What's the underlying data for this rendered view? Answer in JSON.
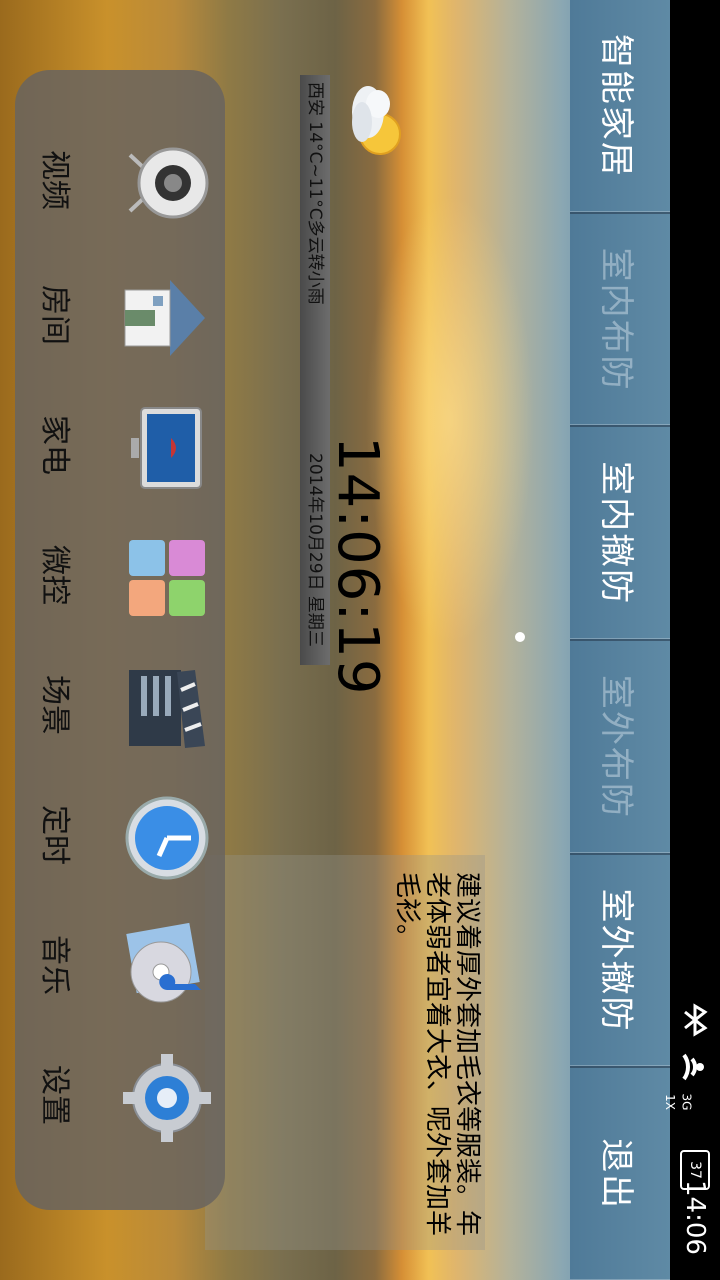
{
  "status_bar": {
    "time": "14:06",
    "battery": "37",
    "network_3g": "3G",
    "network_1x": "1X"
  },
  "menu": {
    "items": [
      {
        "label": "智能家居",
        "dim": false
      },
      {
        "label": "室内布防",
        "dim": true
      },
      {
        "label": "室内撤防",
        "dim": false
      },
      {
        "label": "室外布防",
        "dim": true
      },
      {
        "label": "室外撤防",
        "dim": false
      },
      {
        "label": "退出",
        "dim": false
      }
    ]
  },
  "weather": {
    "text": "西安 14°C~11°C多云转小雨",
    "icon": "cloudy-sun-icon"
  },
  "clock": {
    "time": "14:06:19",
    "date": "2014年10月29日 星期三"
  },
  "advice": {
    "text": "建议着厚外套加毛衣等服装。年老体弱者宜着大衣、呢外套加羊毛衫。"
  },
  "dock": {
    "items": [
      {
        "label": "视频",
        "icon": "webcam-icon"
      },
      {
        "label": "房间",
        "icon": "house-icon"
      },
      {
        "label": "家电",
        "icon": "tv-icon"
      },
      {
        "label": "微控",
        "icon": "tiles-icon"
      },
      {
        "label": "场景",
        "icon": "clapperboard-icon"
      },
      {
        "label": "定时",
        "icon": "clock-icon"
      },
      {
        "label": "音乐",
        "icon": "music-cd-icon"
      },
      {
        "label": "设置",
        "icon": "gear-icon"
      }
    ]
  },
  "colors": {
    "menu_bar": "#5a86a2",
    "dock": "#69645f",
    "sky": "#6c93ab",
    "sunset": "#f1c155"
  }
}
